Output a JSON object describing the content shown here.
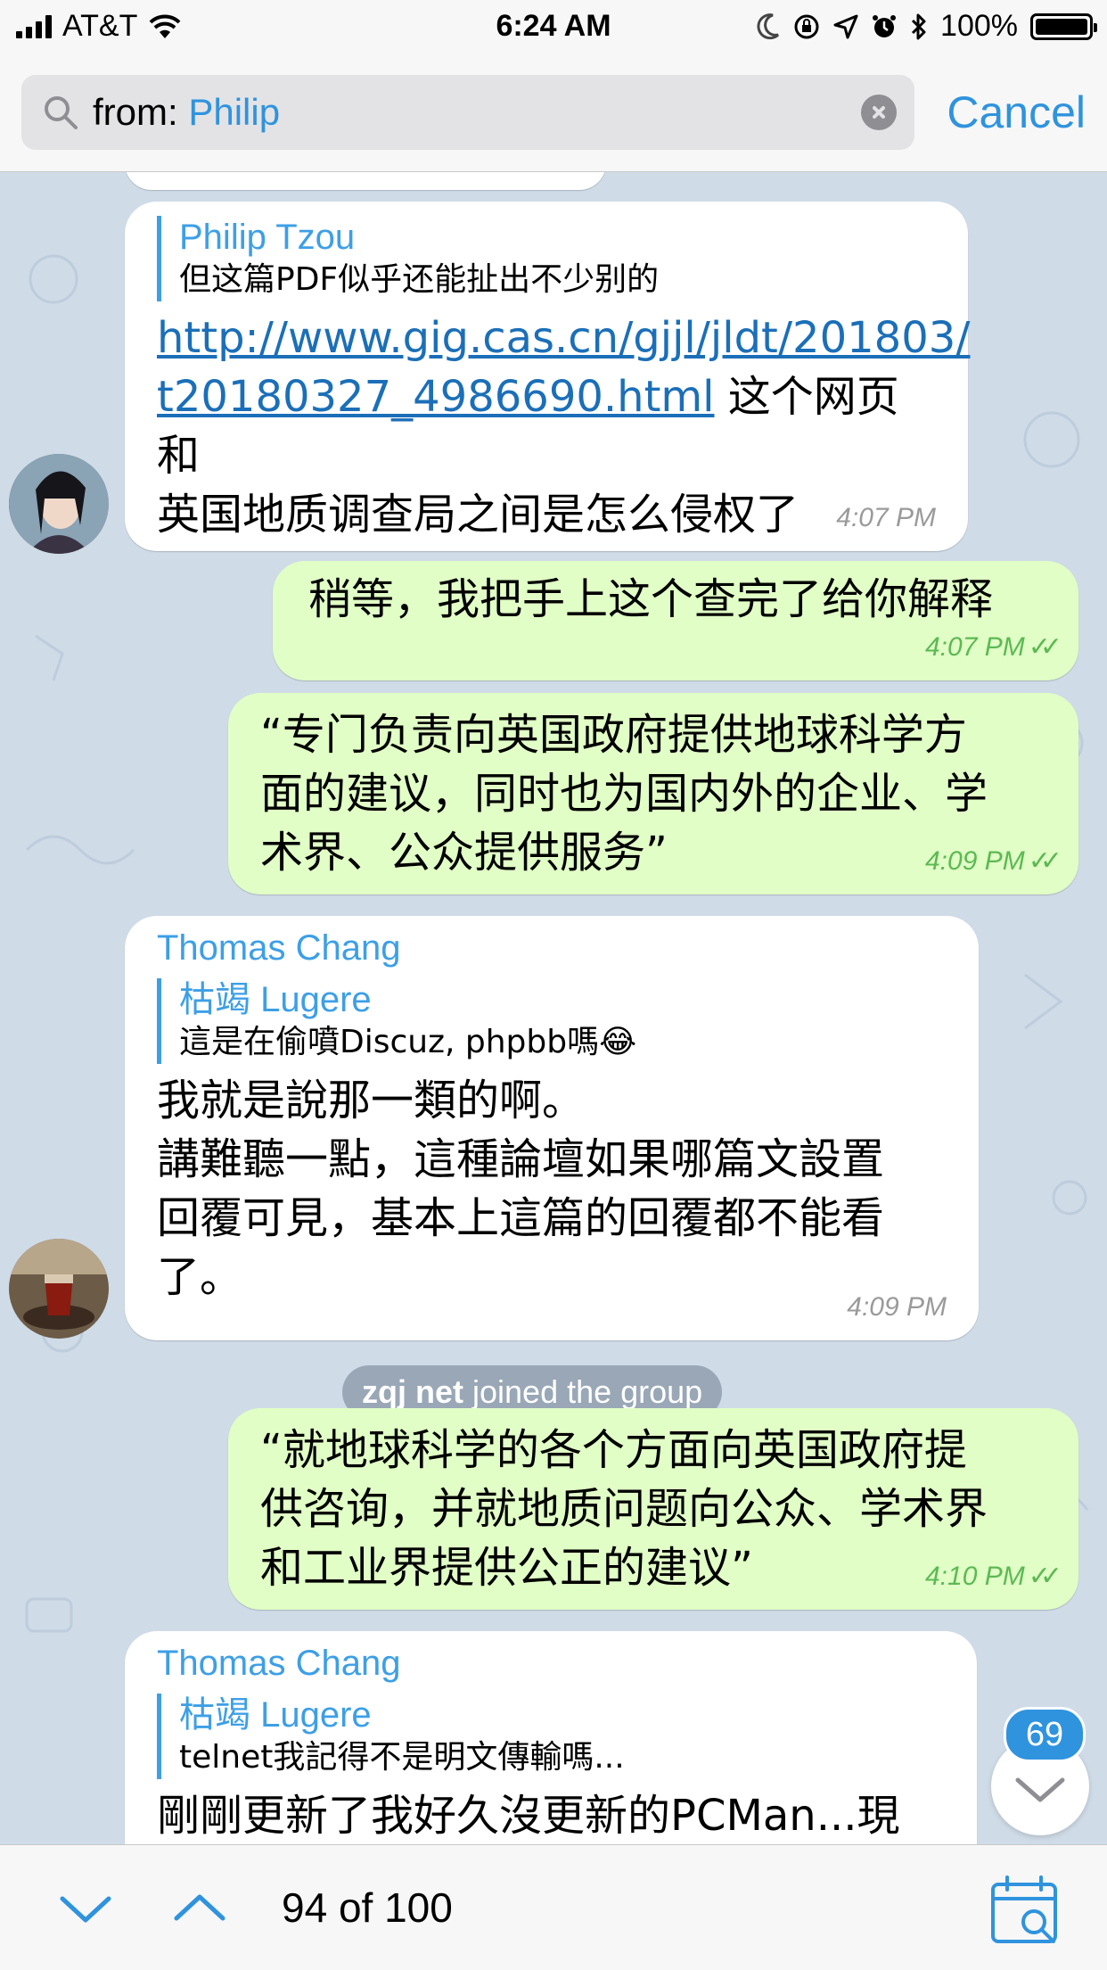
{
  "status_bar": {
    "carrier": "AT&T",
    "time": "6:24 AM",
    "battery": "100%",
    "icons": [
      "signal-icon",
      "wifi-icon",
      "moon-icon",
      "orientation-lock-icon",
      "location-icon",
      "alarm-icon",
      "bluetooth-icon",
      "battery-icon"
    ]
  },
  "search": {
    "prefix": "from: ",
    "query": "Philip",
    "cancel_label": "Cancel"
  },
  "messages": [
    {
      "reply_name": "Philip Tzou",
      "reply_text": "但这篇PDF似乎还能扯出不少别的",
      "link_line1": "http://www.gig.cas.cn/gjjl/jldt/201803/",
      "link_line2": "t20180327_4986690.html",
      "text_after_link": " 这个网页和",
      "text_line3": "英国地质调查局之间是怎么侵权了",
      "time": "4:07 PM"
    },
    {
      "text": "稍等，我把手上这个查完了给你解释",
      "time": "4:07 PM"
    },
    {
      "lines": [
        "“专门负责向英国政府提供地球科学方",
        "面的建议，同时也为国内外的企业、学",
        "术界、公众提供服务”"
      ],
      "time": "4:09 PM"
    },
    {
      "sender": "Thomas Chang",
      "reply_name": "枯竭 Lugere",
      "reply_text": "這是在偷噴Discuz, phpbb嗎😂",
      "lines": [
        "我就是說那一類的啊。",
        "講難聽一點，這種論壇如果哪篇文設置",
        "回覆可見，基本上這篇的回覆都不能看",
        "了。"
      ],
      "time": "4:09 PM"
    },
    {
      "service_name": "zqj net",
      "service_text": " joined the group"
    },
    {
      "lines": [
        "“就地球科学的各个方面向英国政府提",
        "供咨询，并就地质问题向公众、学术界",
        "和工业界提供公正的建议”"
      ],
      "time": "4:10 PM"
    },
    {
      "sender": "Thomas Chang",
      "reply_name": "枯竭 Lugere",
      "reply_text": "telnet我記得不是明文傳輸嗎...",
      "text": "剛剛更新了我好久沒更新的PCMan...現"
    }
  ],
  "scroll_badge": "69",
  "bottom_bar": {
    "counter": "94 of 100"
  },
  "colors": {
    "accent": "#2f93de",
    "outgoing_bubble": "#e1fec6",
    "incoming_bubble": "#ffffff",
    "chat_background": "#cfdbe7"
  }
}
